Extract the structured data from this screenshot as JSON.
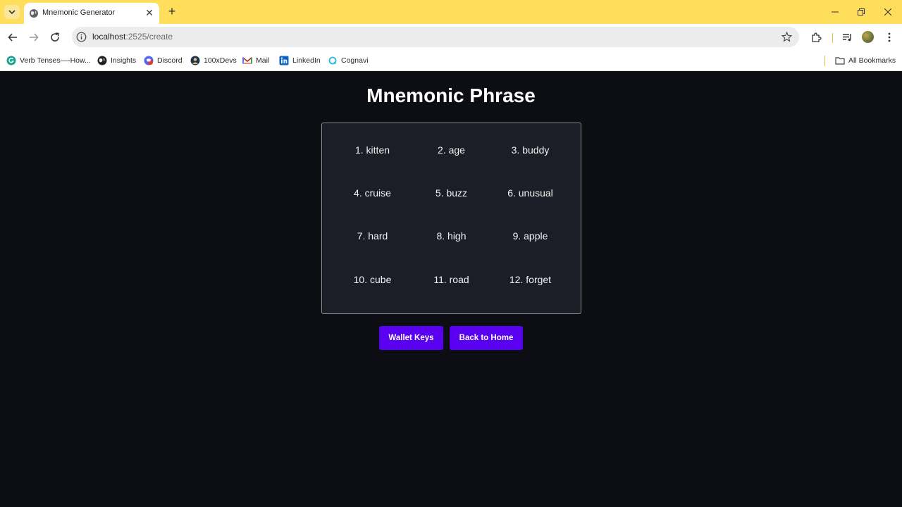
{
  "browser": {
    "tab": {
      "title": "Mnemonic Generator"
    },
    "address_bar": {
      "host": "localhost",
      "path": ":2525/create"
    },
    "bookmarks": [
      {
        "label": "Verb Tenses—-How...",
        "icon": "grammarly-icon"
      },
      {
        "label": "Insights",
        "icon": "insights-icon"
      },
      {
        "label": "Discord",
        "icon": "discord-icon"
      },
      {
        "label": "100xDevs",
        "icon": "100xdevs-icon"
      },
      {
        "label": "Mail",
        "icon": "gmail-icon"
      },
      {
        "label": "LinkedIn",
        "icon": "linkedin-icon"
      },
      {
        "label": "Cognavi",
        "icon": "cognavi-icon"
      }
    ],
    "all_bookmarks_label": "All Bookmarks",
    "colors": {
      "tabstrip": "#ffde5c"
    }
  },
  "page": {
    "title": "Mnemonic Phrase",
    "words": [
      "1. kitten",
      "2. age",
      "3. buddy",
      "4. cruise",
      "5. buzz",
      "6. unusual",
      "7. hard",
      "8. high",
      "9. apple",
      "10. cube",
      "11. road",
      "12. forget"
    ],
    "buttons": {
      "wallet_keys": "Wallet Keys",
      "back_home": "Back to Home"
    },
    "colors": {
      "background": "#0d0e14",
      "panel": "#1b1e26",
      "accent": "#5a00f0"
    }
  }
}
